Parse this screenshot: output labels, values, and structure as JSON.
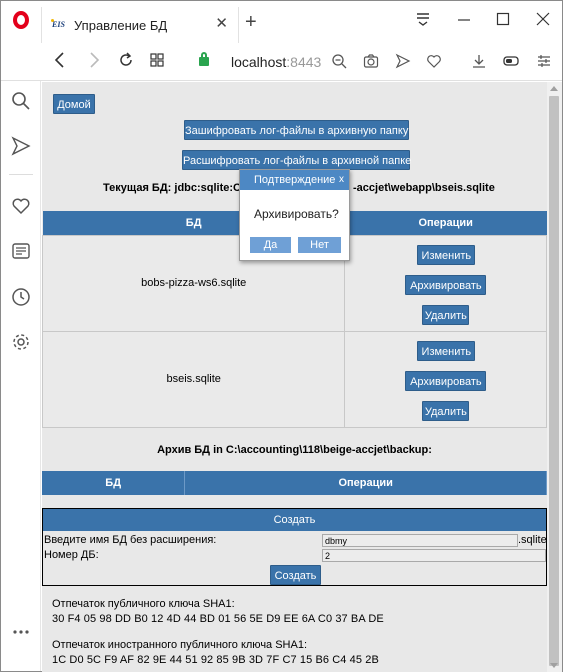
{
  "browser": {
    "tab_title": "Управление БД",
    "tab_favicon": "EIS",
    "tab_close": "✕",
    "new_tab": "+",
    "url_host": "localhost",
    "url_port": ":8443",
    "icons": [
      "opera-icon",
      "back-icon",
      "forward-icon",
      "reload-icon",
      "speed-dial-icon",
      "lock-icon",
      "search-zoom-icon",
      "camera-icon",
      "send-icon",
      "heart-icon",
      "download-icon",
      "battery-icon",
      "settings-sliders-icon"
    ],
    "sidebar_icons": [
      "search-icon",
      "send-icon",
      "heart-icon",
      "news-icon",
      "history-icon",
      "settings-icon",
      "more-icon"
    ]
  },
  "page": {
    "home_button": "Домой",
    "encrypt_button": "Зашифровать лог-файлы в архивную папку",
    "decrypt_button": "Расшифровать лог-файлы в архивной папке",
    "current_db_prefix": "Текущая БД: jdbc:sqlite:C:\\",
    "current_db_suffix": "-accjet\\webapp\\bseis.sqlite",
    "db_table": {
      "headers": [
        "БД",
        "Операции"
      ],
      "rows": [
        {
          "name": "bobs-pizza-ws6.sqlite",
          "actions": [
            "Изменить",
            "Архивировать",
            "Удалить"
          ]
        },
        {
          "name": "bseis.sqlite",
          "actions": [
            "Изменить",
            "Архивировать",
            "Удалить"
          ]
        }
      ]
    },
    "archive_title": "Архив БД in C:\\accounting\\118\\beige-accjet\\backup:",
    "archive_table": {
      "headers": [
        "БД",
        "Операции"
      ]
    },
    "create_form": {
      "header": "Создать",
      "name_label": "Введите имя БД без расширения:",
      "name_value": "dbmy",
      "name_suffix": ".sqlite",
      "number_label": "Номер ДБ:",
      "number_value": "2",
      "submit": "Создать"
    },
    "public_key_label": "Отпечаток публичного ключа SHA1:",
    "public_key_value": "30 F4 05 98 DD B0 12 4D 44 BD 01 56 5E D9 EE 6A C0 37 BA DE",
    "foreign_key_label": "Отпечаток иностранного публичного ключа SHA1:",
    "foreign_key_value": "1C D0 5C F9 AF 82 9E 44 51 92 85 9B 3D 7F C7 15 B6 C4 45 2B"
  },
  "modal": {
    "title": "Подтверждение",
    "close": "x",
    "message": "Архивировать?",
    "yes": "Да",
    "no": "Нет"
  },
  "colors": {
    "button": "#3a73aa",
    "modal_header": "#4d88c4",
    "modal_button": "#6fa0d6",
    "page_bg": "#e8e8e8"
  }
}
